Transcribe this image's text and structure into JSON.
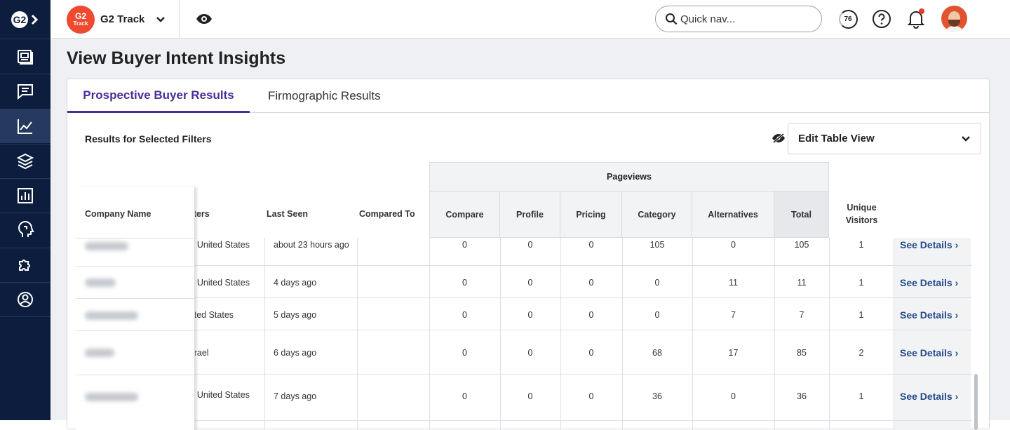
{
  "nav": {
    "logo": "G2",
    "items": [
      {
        "name": "reports-icon"
      },
      {
        "name": "reviews-icon"
      },
      {
        "name": "buyer-intent-icon",
        "active": true
      },
      {
        "name": "layers-icon"
      },
      {
        "name": "bar-chart-icon"
      },
      {
        "name": "head-insights-icon"
      },
      {
        "name": "integrations-icon"
      },
      {
        "name": "profile-icon"
      }
    ]
  },
  "topbar": {
    "badge_top": "G2",
    "badge_bottom": "Track",
    "product": "G2 Track",
    "search_placeholder": "Quick nav...",
    "credits": "76"
  },
  "page": {
    "title": "View Buyer Intent Insights",
    "tabs": [
      "Prospective Buyer Results",
      "Firmographic Results"
    ],
    "filters_label": "Results for Selected Filters",
    "edit_view": "Edit Table View"
  },
  "table": {
    "headers": {
      "company": "Company Name",
      "hq": "arters",
      "last_seen": "Last Seen",
      "compared_to": "Compared To",
      "pageviews": "Pageviews",
      "unique_1": "Unique",
      "unique_2": "Visitors"
    },
    "pageview_columns": [
      "Compare",
      "Profile",
      "Pricing",
      "Category",
      "Alternatives",
      "Total"
    ],
    "see_details": "See Details ›",
    "rows": [
      {
        "hq": "a, United States",
        "last_seen": "about 23 hours ago",
        "compare": "0",
        "profile": "0",
        "pricing": "0",
        "category": "105",
        "alternatives": "0",
        "total": "105",
        "unique": "1"
      },
      {
        "hq": "a, United States",
        "last_seen": "4 days ago",
        "compare": "0",
        "profile": "0",
        "pricing": "0",
        "category": "0",
        "alternatives": "11",
        "total": "11",
        "unique": "1"
      },
      {
        "hq": "nited States",
        "last_seen": "5 days ago",
        "compare": "0",
        "profile": "0",
        "pricing": "0",
        "category": "0",
        "alternatives": "7",
        "total": "7",
        "unique": "1"
      },
      {
        "hq": "Israel",
        "last_seen": "6 days ago",
        "compare": "0",
        "profile": "0",
        "pricing": "0",
        "category": "68",
        "alternatives": "17",
        "total": "85",
        "unique": "2"
      },
      {
        "hq": "o, United States",
        "last_seen": "7 days ago",
        "compare": "0",
        "profile": "0",
        "pricing": "0",
        "category": "36",
        "alternatives": "0",
        "total": "36",
        "unique": "1"
      }
    ]
  }
}
